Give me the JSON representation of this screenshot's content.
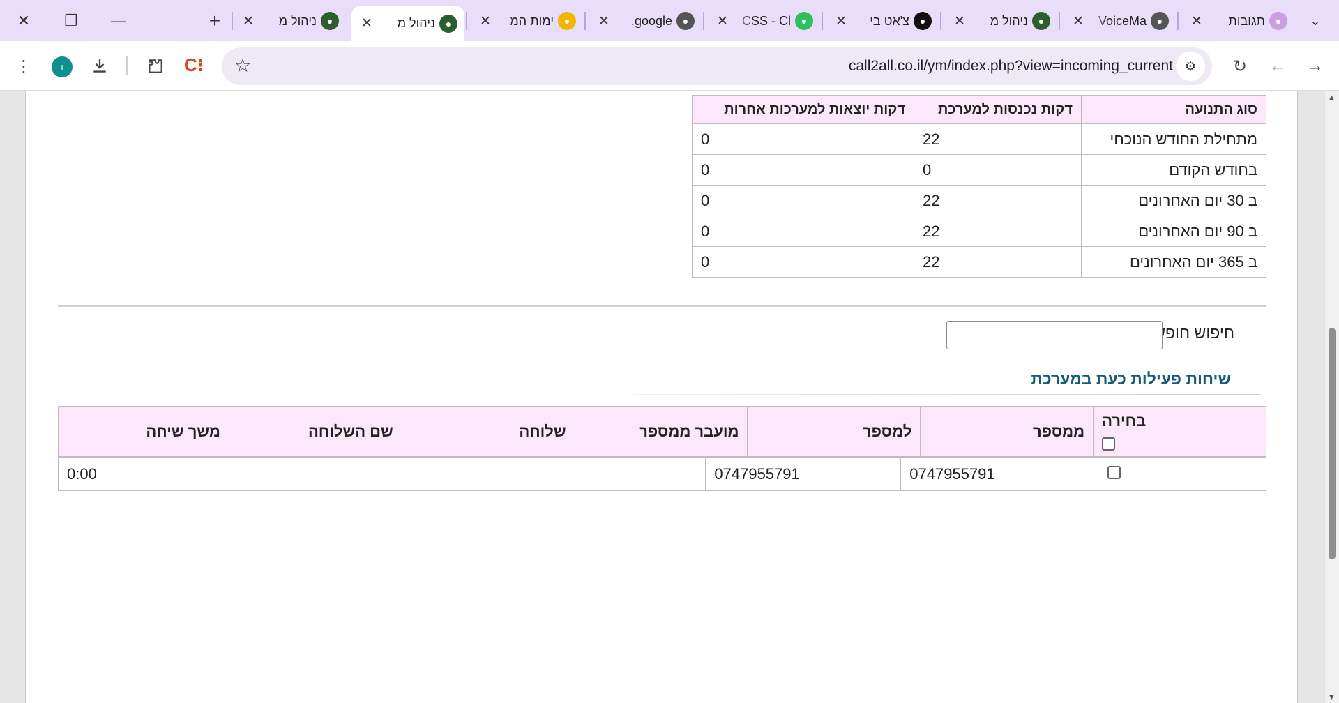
{
  "browser": {
    "tabs": [
      {
        "title": "תגובות",
        "icon": "fox-yellow-icon",
        "color": "#c8a0e0",
        "active": false
      },
      {
        "title": "VoiceMa",
        "icon": "globe-icon",
        "color": "#555555",
        "active": false
      },
      {
        "title": "ניהול מ",
        "icon": "yemot-logo-icon",
        "color": "#2c5f2d",
        "active": false
      },
      {
        "title": "צ'אט בי",
        "icon": "openai-icon",
        "color": "#111111",
        "active": false
      },
      {
        "title": "CSS - Cl",
        "icon": "chat-bubble-icon",
        "color": "#2fbf5f",
        "active": false
      },
      {
        "title": "google.",
        "icon": "globe-icon",
        "color": "#555555",
        "active": false
      },
      {
        "title": "ימות המ",
        "icon": "star-burst-icon",
        "color": "#f5b400",
        "active": false
      },
      {
        "title": "ניהול מ",
        "icon": "yemot-logo-icon",
        "color": "#2c5f2d",
        "active": true
      },
      {
        "title": "ניהול מ",
        "icon": "yemot-logo-icon",
        "color": "#2c5f2d",
        "active": false
      }
    ],
    "url": "call2all.co.il/ym/index.php?view=incoming_current",
    "profile_initial": "ו"
  },
  "summary": {
    "headers": [
      "סוג התנועה",
      "דקות נכנסות למערכת",
      "דקות יוצאות למערכות אחרות"
    ],
    "rows": [
      [
        "מתחילת החודש הנוכחי",
        "22",
        "0"
      ],
      [
        "בחודש הקודם",
        "0",
        "0"
      ],
      [
        "ב 30 יום האחרונים",
        "22",
        "0"
      ],
      [
        "ב 90 יום האחרונים",
        "22",
        "0"
      ],
      [
        "ב 365 יום האחרונים",
        "22",
        "0"
      ]
    ]
  },
  "search": {
    "label": "חיפוש חופשי",
    "value": ""
  },
  "calls": {
    "title": "שיחות פעילות כעת במערכת",
    "headers": [
      "בחירה",
      "ממספר",
      "למספר",
      "מועבר ממספר",
      "שלוחה",
      "שם השלוחה",
      "משך שיחה"
    ],
    "rows": [
      {
        "from": "0747955791",
        "to": "0747955791",
        "forwarded": "",
        "extension": "",
        "extension_name": "",
        "duration": "0:00"
      }
    ]
  }
}
